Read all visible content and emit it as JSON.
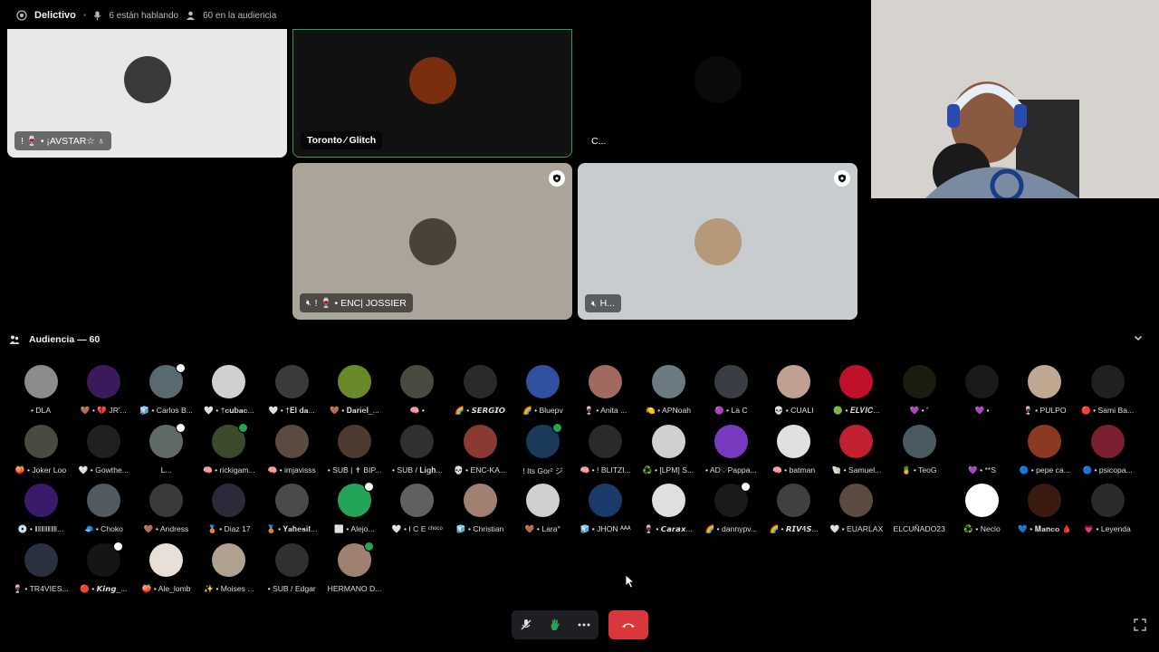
{
  "header": {
    "channel": "Delictivo",
    "speaking": "6 están hablando",
    "audience_count": "60 en la audiencia"
  },
  "stage": {
    "tiles": [
      {
        "name": "! 🍷 • ¡AVSTAR☆ ♁",
        "bg": "#e8e8e8",
        "avatar": "#3a3a3a",
        "show_badge": false,
        "highlight": false
      },
      {
        "name": "Toronto ⁄ Glitch",
        "bg": "#111111",
        "avatar": "#7a2e10",
        "show_badge": false,
        "highlight": true
      },
      {
        "name": "C...",
        "bg": "#000000",
        "avatar": "#0a0a0a",
        "show_badge": false,
        "highlight": false
      },
      {
        "name": "! 🍷 • ENC| JOSSIER",
        "bg": "#aaa49a",
        "avatar": "#4a4238",
        "show_badge": true,
        "highlight": false
      },
      {
        "name": "H...",
        "bg": "#c7ccce",
        "avatar": "#b59a7a",
        "show_badge": true,
        "highlight": false
      }
    ]
  },
  "audience": {
    "title": "Audiencia — 60",
    "members": [
      {
        "name": "• DLA",
        "color": "#8c8c8c",
        "mini": ""
      },
      {
        "name": "🤎 • 💔 JR'...",
        "color": "#3a1a5a",
        "mini": ""
      },
      {
        "name": "🧊 • Carlos B...",
        "color": "#5a6a70",
        "mini": "white"
      },
      {
        "name": "🤍 • †𝐜𝐮𝐛𝐚𝐜...",
        "color": "#d0d0d0",
        "mini": ""
      },
      {
        "name": "🤍 • †𝐄𝐥 𝐝𝐚...",
        "color": "#3a3a3a",
        "mini": ""
      },
      {
        "name": "🤎 • 𝐃𝐚𝐫𝐢𝐞𝐥_...",
        "color": "#6a8a2a",
        "mini": ""
      },
      {
        "name": "🧠 •",
        "color": "#4a4a40",
        "mini": ""
      },
      {
        "name": "🌈 • 𝙎𝙀𝙍𝙂𝙄𝙊",
        "color": "#2a2a2a",
        "mini": ""
      },
      {
        "name": "🌈 • Bluepv",
        "color": "#3050a0",
        "mini": ""
      },
      {
        "name": "🍷 • Anita ...",
        "color": "#a06a60",
        "mini": ""
      },
      {
        "name": "🍋 • APNoah",
        "color": "#6a7a80",
        "mini": ""
      },
      {
        "name": "🟣 • La C",
        "color": "#3a3e44",
        "mini": ""
      },
      {
        "name": "💀 • CUALI",
        "color": "#c0a090",
        "mini": ""
      },
      {
        "name": "🟢 • 𝑬𝑳𝑽𝑰𝑪...",
        "color": "#c0102a",
        "mini": ""
      },
      {
        "name": "💜 • ˚",
        "color": "#1a1c10",
        "mini": ""
      },
      {
        "name": "💜 •",
        "color": "#1a1a1a",
        "mini": ""
      },
      {
        "name": "🍷 • PULPO",
        "color": "#c0a890",
        "mini": ""
      },
      {
        "name": "🔴 • Sami Ba...",
        "color": "#202020",
        "mini": ""
      },
      {
        "name": "🍑 • Joker Loo",
        "color": "#4a4a40",
        "mini": ""
      },
      {
        "name": "🤍 • Gowthe...",
        "color": "#202020",
        "mini": ""
      },
      {
        "name": "L...",
        "color": "#606a66",
        "mini": "white"
      },
      {
        "name": "🧠 • rickigam...",
        "color": "#3a4a2a",
        "mini": "green"
      },
      {
        "name": "🧠 • imjavisss",
        "color": "#5a4a40",
        "mini": ""
      },
      {
        "name": "• SUB | ✝ BIP...",
        "color": "#4a3a30",
        "mini": ""
      },
      {
        "name": "• SUB / 𝐋𝐢𝐠𝐡...",
        "color": "#303030",
        "mini": ""
      },
      {
        "name": "💀 • ENC-KA...",
        "color": "#8a3a30",
        "mini": ""
      },
      {
        "name": "! Its Gor² ジ",
        "color": "#1a3a5a",
        "mini": "green"
      },
      {
        "name": "🧠 • ! BLITZI...",
        "color": "#2a2a2a",
        "mini": ""
      },
      {
        "name": "♻️ • [LPM] S...",
        "color": "#d0d0d0",
        "mini": ""
      },
      {
        "name": "• AD♡Pappa...",
        "color": "#7a3ac0",
        "mini": ""
      },
      {
        "name": "🧠 • batman",
        "color": "#e0e0e0",
        "mini": ""
      },
      {
        "name": "🐚 • Samuel...",
        "color": "#c02030",
        "mini": ""
      },
      {
        "name": "🍍 • TeoG",
        "color": "#4a5a60",
        "mini": ""
      },
      {
        "name": "💜 • **S",
        "color": "#000000",
        "mini": ""
      },
      {
        "name": "🔵 • pepe ca...",
        "color": "#8a3a20",
        "mini": ""
      },
      {
        "name": "🔵 • psicopa...",
        "color": "#7a2030",
        "mini": ""
      },
      {
        "name": "💿 • ‖‖‖‖‖‖‖...",
        "color": "#3a1a6a",
        "mini": ""
      },
      {
        "name": "🧢 • Choko",
        "color": "#505a60",
        "mini": ""
      },
      {
        "name": "🤎 • Andress",
        "color": "#3a3a3a",
        "mini": ""
      },
      {
        "name": "🥉 • Diaz 17",
        "color": "#2a2a3a",
        "mini": ""
      },
      {
        "name": "🥉 • 𝐘𝐚𝐡𝐞𝐬𝐢𝐭...",
        "color": "#4a4a4a",
        "mini": ""
      },
      {
        "name": "⬜ • Alejo...",
        "color": "#23a559",
        "mini": "white"
      },
      {
        "name": "🤍 • I C E ᶜʰᵒᶜᵒ",
        "color": "#606060",
        "mini": ""
      },
      {
        "name": "🧊 • Christian",
        "color": "#a08070",
        "mini": ""
      },
      {
        "name": "🤎 • Lara°",
        "color": "#d0d0d0",
        "mini": ""
      },
      {
        "name": "🧊 • JHON ᴬᴬᴬ",
        "color": "#1a3a6a",
        "mini": ""
      },
      {
        "name": "🍷 • 𝘾𝙖𝙧𝙖𝙭...",
        "color": "#e0e0e0",
        "mini": ""
      },
      {
        "name": "🌈 • dannypv...",
        "color": "#1a1a1a",
        "mini": "white"
      },
      {
        "name": "🌈 • 𝙍𝙄𝙑𝟒𝙎...",
        "color": "#404040",
        "mini": ""
      },
      {
        "name": "🤍 • EUARLAX",
        "color": "#5a4a40",
        "mini": ""
      },
      {
        "name": "ELCUÑADO23",
        "color": "#000000",
        "mini": ""
      },
      {
        "name": "♻️ • Necio",
        "color": "#ffffff",
        "mini": ""
      },
      {
        "name": "💙 • 𝐌𝐚𝐧𝐜𝐨 🩸",
        "color": "#3a1a10",
        "mini": ""
      },
      {
        "name": "💗 • Leyenda",
        "color": "#2a2a2a",
        "mini": ""
      },
      {
        "name": "🍷 • TR4VIES...",
        "color": "#2a3040",
        "mini": ""
      },
      {
        "name": "🔴 • 𝙆𝙞𝙣𝙜_...",
        "color": "#151515",
        "mini": "white"
      },
      {
        "name": "🍑 • Ale_lomb",
        "color": "#e8e0d8",
        "mini": ""
      },
      {
        "name": "✨ • Moises ...",
        "color": "#b0a090",
        "mini": ""
      },
      {
        "name": "• SUB / Edgar",
        "color": "#303030",
        "mini": ""
      },
      {
        "name": "HERMANO D...",
        "color": "#a08070",
        "mini": "green"
      }
    ]
  },
  "colors": {
    "accent_green": "#23a559",
    "hangup_red": "#da373c"
  },
  "controls": {
    "mute_icon": "mic-off-icon",
    "hand_icon": "raise-hand-icon",
    "more_icon": "more-icon",
    "hangup_icon": "hangup-icon",
    "fullscreen_icon": "fullscreen-icon"
  }
}
